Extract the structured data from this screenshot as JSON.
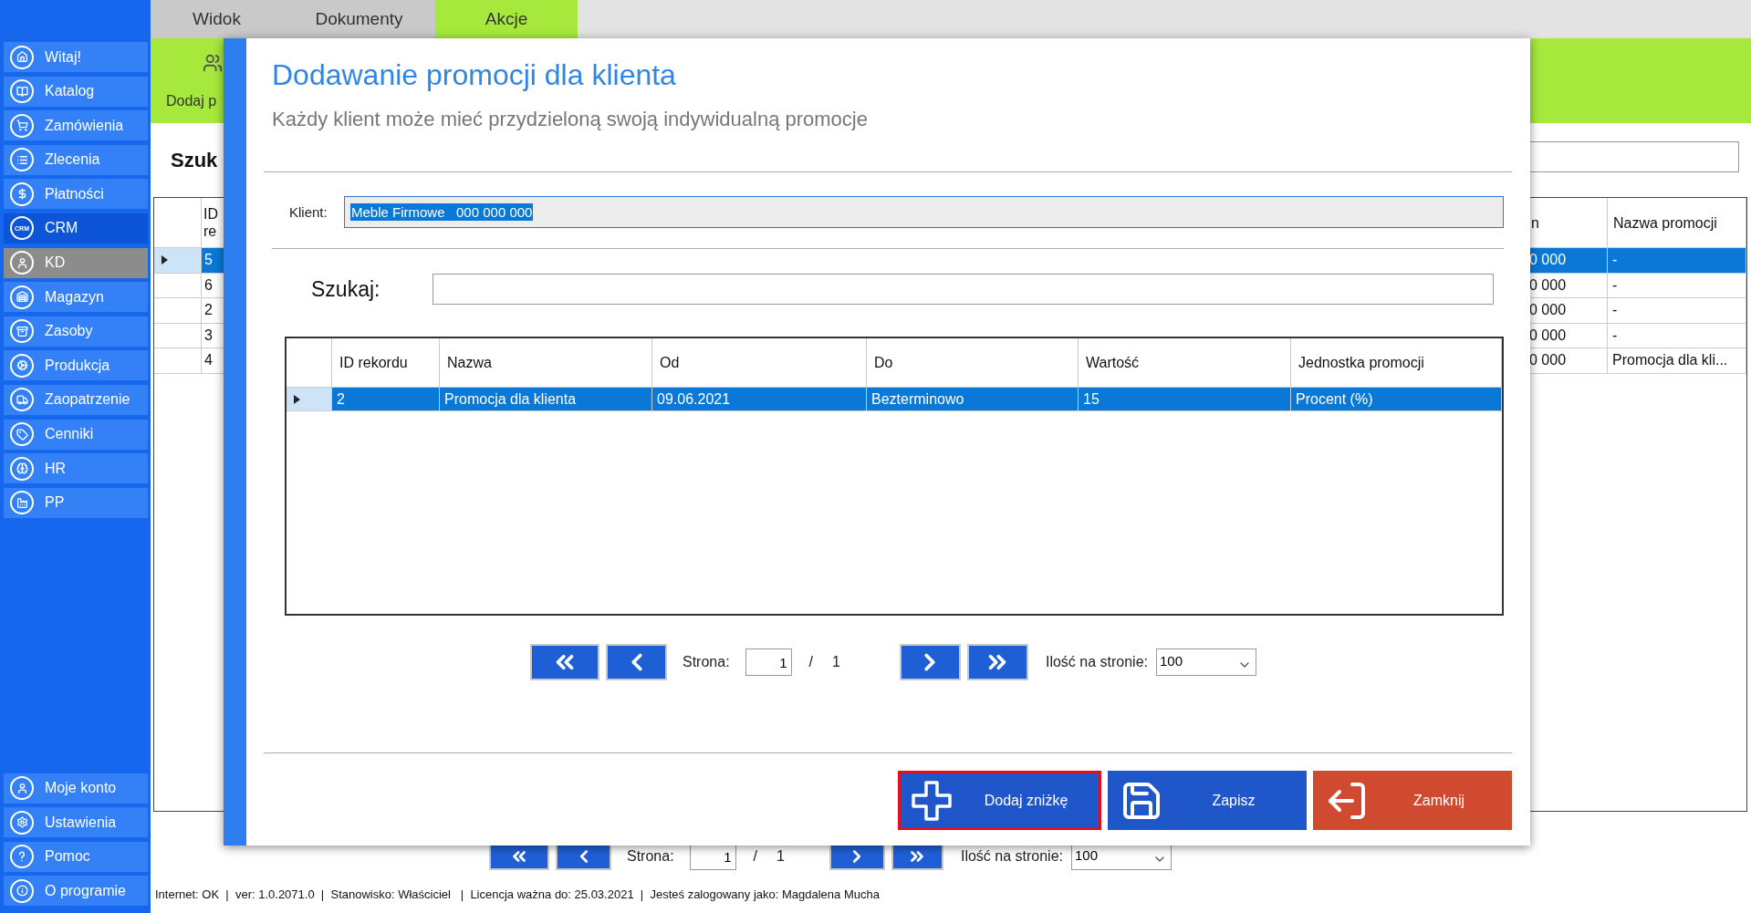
{
  "sidebar": {
    "items": [
      {
        "label": "Witaj!",
        "selected": false,
        "disabled": false
      },
      {
        "label": "Katalog",
        "selected": false,
        "disabled": false
      },
      {
        "label": "Zamówienia",
        "selected": false,
        "disabled": false
      },
      {
        "label": "Zlecenia",
        "selected": false,
        "disabled": false
      },
      {
        "label": "Płatności",
        "selected": false,
        "disabled": false
      },
      {
        "label": "CRM",
        "icon_text": "CRM",
        "selected": true,
        "disabled": false
      },
      {
        "label": "KD",
        "selected": false,
        "disabled": true
      },
      {
        "label": "Magazyn",
        "selected": false,
        "disabled": false
      },
      {
        "label": "Zasoby",
        "selected": false,
        "disabled": false
      },
      {
        "label": "Produkcja",
        "selected": false,
        "disabled": false
      },
      {
        "label": "Zaopatrzenie",
        "selected": false,
        "disabled": false
      },
      {
        "label": "Cenniki",
        "selected": false,
        "disabled": false
      },
      {
        "label": "HR",
        "selected": false,
        "disabled": false
      },
      {
        "label": "PP",
        "selected": false,
        "disabled": false
      }
    ],
    "bottom_items": [
      {
        "label": "Moje konto"
      },
      {
        "label": "Ustawienia"
      },
      {
        "label": "Pomoc"
      },
      {
        "label": "O programie"
      }
    ]
  },
  "tabs": [
    {
      "label": "Widok",
      "selected": false
    },
    {
      "label": "Dokumenty",
      "selected": false
    },
    {
      "label": "Akcje",
      "selected": true
    }
  ],
  "ribbon": {
    "action_label": "Dodaj p"
  },
  "search_label": "Szuk",
  "table": {
    "columns": [
      "ID re",
      "n",
      "Nazwa promocji"
    ],
    "rows": [
      {
        "cells": [
          "5",
          "0 000",
          "-"
        ],
        "selected": true
      },
      {
        "cells": [
          "6",
          "0 000",
          "-"
        ],
        "selected": false
      },
      {
        "cells": [
          "2",
          "0 000",
          "-"
        ],
        "selected": false
      },
      {
        "cells": [
          "3",
          "0 000",
          "-"
        ],
        "selected": false
      },
      {
        "cells": [
          "4",
          "0 000",
          "Promocja dla kli..."
        ],
        "selected": false
      }
    ]
  },
  "pager": {
    "page_label": "Strona:",
    "page": "1",
    "separator": "/",
    "total": "1",
    "per_page_label": "Ilość na stronie:",
    "per_page": "100"
  },
  "dialog": {
    "title": "Dodawanie promocji dla klienta",
    "subtitle": "Każdy klient może mieć przydzieloną swoją indywidualną promocje",
    "client_label": "Klient:",
    "client_value": "Meble Firmowe   000 000 000",
    "search_label": "Szukaj:",
    "table": {
      "columns": [
        "ID rekordu",
        "Nazwa",
        "Od",
        "Do",
        "Wartość",
        "Jednostka promocji"
      ],
      "rows": [
        {
          "cells": [
            "2",
            "Promocja dla klienta",
            "09.06.2021",
            "Bezterminowo",
            "15",
            "Procent (%)"
          ],
          "selected": true
        }
      ]
    },
    "pager": {
      "page_label": "Strona:",
      "page": "1",
      "separator": "/",
      "total": "1",
      "per_page_label": "Ilość na stronie:",
      "per_page": "100"
    },
    "buttons": [
      {
        "label": "Dodaj zniżkę",
        "kind": "add",
        "focused": true
      },
      {
        "label": "Zapisz",
        "kind": "save",
        "focused": false
      },
      {
        "label": "Zamknij",
        "kind": "close",
        "focused": false
      }
    ]
  },
  "status_bar": "Internet: OK  |  ver: 1.0.2071.0  |  Stanowisko: Właściciel   |  Licencja ważna do: 25.03.2021  |  Jesteś zalogowany jako: Magdalena Mucha"
}
